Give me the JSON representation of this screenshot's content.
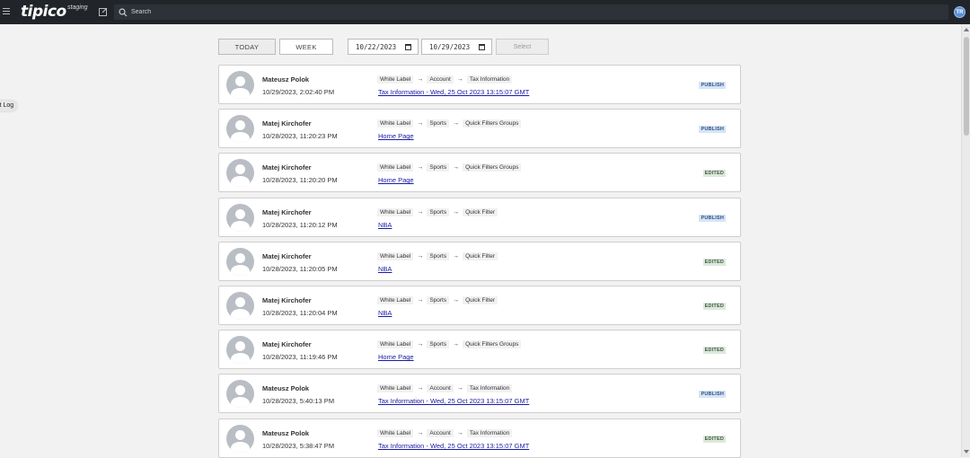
{
  "header": {
    "logo": "tipico",
    "environment": "staging",
    "search_placeholder": "Search",
    "user_initials": "TR"
  },
  "side_tab": {
    "label": "it Log"
  },
  "filters": {
    "today_label": "TODAY",
    "week_label": "WEEK",
    "date_from": "10/22/2023",
    "date_to": "10/29/2023",
    "select_label": "Select"
  },
  "entries": [
    {
      "user": "Mateusz Polok",
      "time": "10/29/2023, 2:02:40 PM",
      "path": [
        "White Label",
        "Account",
        "Tax Information"
      ],
      "link": "Tax Information - Wed, 25 Oct 2023 13:15:07 GMT",
      "status": "PUBLISH"
    },
    {
      "user": "Matej Kirchofer",
      "time": "10/28/2023, 11:20:23 PM",
      "path": [
        "White Label",
        "Sports",
        "Quick Filters Groups"
      ],
      "link": "Home Page",
      "status": "PUBLISH"
    },
    {
      "user": "Matej Kirchofer",
      "time": "10/28/2023, 11:20:20 PM",
      "path": [
        "White Label",
        "Sports",
        "Quick Filters Groups"
      ],
      "link": "Home Page",
      "status": "EDITED"
    },
    {
      "user": "Matej Kirchofer",
      "time": "10/28/2023, 11:20:12 PM",
      "path": [
        "White Label",
        "Sports",
        "Quick Filter"
      ],
      "link": "NBA",
      "status": "PUBLISH"
    },
    {
      "user": "Matej Kirchofer",
      "time": "10/28/2023, 11:20:05 PM",
      "path": [
        "White Label",
        "Sports",
        "Quick Filter"
      ],
      "link": "NBA",
      "status": "EDITED"
    },
    {
      "user": "Matej Kirchofer",
      "time": "10/28/2023, 11:20:04 PM",
      "path": [
        "White Label",
        "Sports",
        "Quick Filter"
      ],
      "link": "NBA",
      "status": "EDITED"
    },
    {
      "user": "Matej Kirchofer",
      "time": "10/28/2023, 11:19:46 PM",
      "path": [
        "White Label",
        "Sports",
        "Quick Filters Groups"
      ],
      "link": "Home Page",
      "status": "EDITED"
    },
    {
      "user": "Mateusz Polok",
      "time": "10/28/2023, 5:40:13 PM",
      "path": [
        "White Label",
        "Account",
        "Tax Information"
      ],
      "link": "Tax Information - Wed, 25 Oct 2023 13:15:07 GMT",
      "status": "PUBLISH"
    },
    {
      "user": "Mateusz Polok",
      "time": "10/28/2023, 5:38:47 PM",
      "path": [
        "White Label",
        "Account",
        "Tax Information"
      ],
      "link": "Tax Information - Wed, 25 Oct 2023 13:15:07 GMT",
      "status": "EDITED"
    }
  ],
  "arrow_glyph": "→"
}
